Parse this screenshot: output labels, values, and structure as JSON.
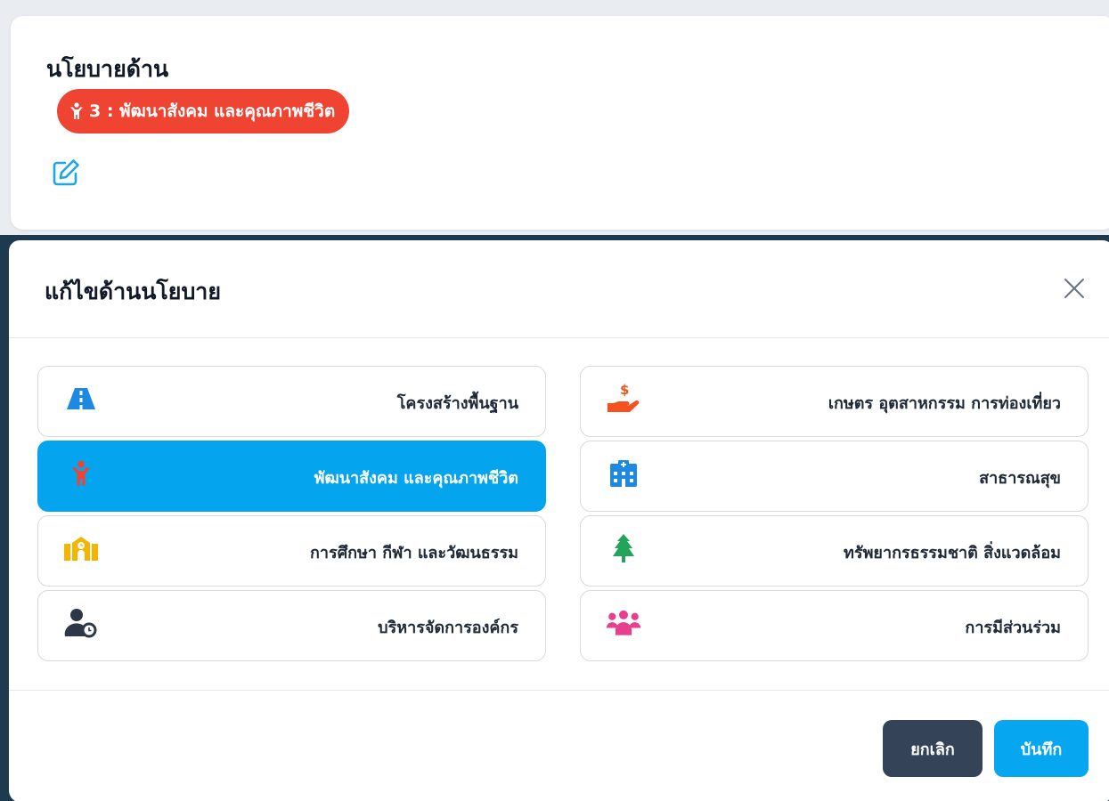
{
  "policy": {
    "title": "นโยบายด้าน",
    "badge_text": "3 : พัฒนาสังคม และคุณภาพชีวิต",
    "badge_icon": "child-icon",
    "badge_color": "#f04433",
    "edit_icon": "edit-icon"
  },
  "modal": {
    "title": "แก้ไขด้านนโยบาย",
    "close_icon": "close-icon",
    "options": [
      {
        "label": "โครงสร้างพื้นฐาน",
        "icon": "road-icon",
        "color": "#1e88e5",
        "selected": false
      },
      {
        "label": "เกษตร อุตสาหกรรม การท่องเที่ยว",
        "icon": "hand-holding-dollar-icon",
        "color": "#f4511e",
        "selected": false
      },
      {
        "label": "พัฒนาสังคม และคุณภาพชีวิต",
        "icon": "child-icon",
        "color": "#f04433",
        "selected": true
      },
      {
        "label": "สาธารณสุข",
        "icon": "hospital-icon",
        "color": "#1e88e5",
        "selected": false
      },
      {
        "label": "การศึกษา กีฬา และวัฒนธรรม",
        "icon": "school-icon",
        "color": "#f5b400",
        "selected": false
      },
      {
        "label": "ทรัพยากรธรรมชาติ สิ่งแวดล้อม",
        "icon": "tree-icon",
        "color": "#22a55b",
        "selected": false
      },
      {
        "label": "บริหารจัดการองค์กร",
        "icon": "user-clock-icon",
        "color": "#2d3748",
        "selected": false
      },
      {
        "label": "การมีส่วนร่วม",
        "icon": "people-group-icon",
        "color": "#e83e8c",
        "selected": false
      }
    ],
    "cancel_label": "ยกเลิก",
    "save_label": "บันทึก"
  },
  "colors": {
    "accent": "#04a4ee",
    "cancel": "#354358",
    "backdrop": "#1e3a4e"
  }
}
